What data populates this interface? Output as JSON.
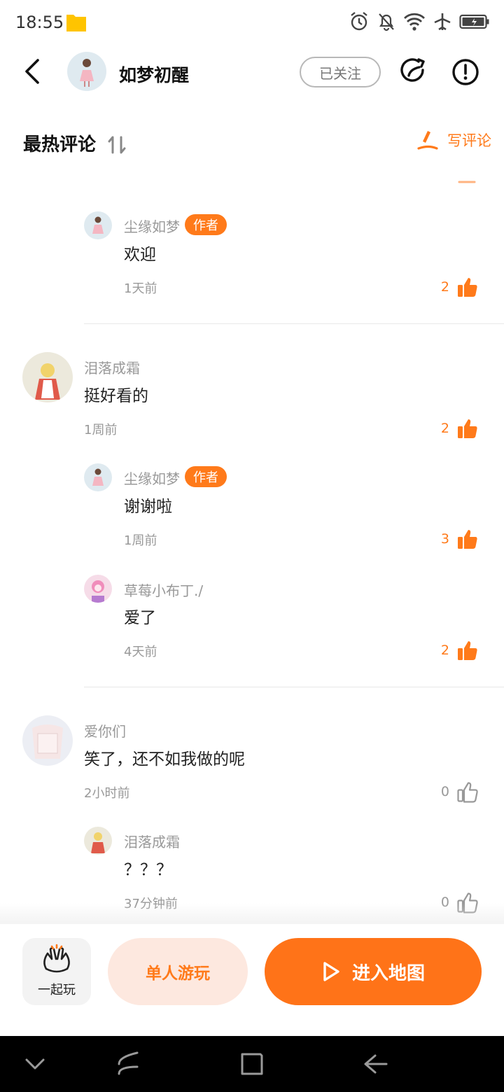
{
  "status_bar": {
    "time": "18:55",
    "icons": [
      "folder-icon",
      "alarm-icon",
      "notifications-off-icon",
      "wifi-icon",
      "airplane-icon",
      "battery-icon"
    ]
  },
  "header": {
    "title": "如梦初醒",
    "follow_label": "已关注",
    "icons": [
      "back-icon",
      "share-icon",
      "report-icon"
    ]
  },
  "section": {
    "title": "最热评论",
    "write_label": "写评论"
  },
  "comments": [
    {
      "kind": "reply",
      "name": "尘缘如梦",
      "tag": "作者",
      "text": "欢迎",
      "time": "1天前",
      "likes": "2",
      "liked": true
    },
    {
      "kind": "top",
      "name": "泪落成霜",
      "text": "挺好看的",
      "time": "1周前",
      "likes": "2",
      "liked": true,
      "replies": [
        {
          "name": "尘缘如梦",
          "tag": "作者",
          "text": "谢谢啦",
          "time": "1周前",
          "likes": "3",
          "liked": true
        },
        {
          "name": "草莓小布丁./",
          "text": "爱了",
          "time": "4天前",
          "likes": "2",
          "liked": true
        }
      ]
    },
    {
      "kind": "top",
      "name": "爱你们",
      "text": "笑了，还不如我做的呢",
      "time": "2小时前",
      "likes": "0",
      "liked": false,
      "replies": [
        {
          "name": "泪落成霜",
          "text": "？？？",
          "time": "37分钟前",
          "likes": "0",
          "liked": false
        }
      ]
    }
  ],
  "action_bar": {
    "play_together_label": "一起玩",
    "solo_label": "单人游玩",
    "enter_label": "进入地图"
  },
  "colors": {
    "accent": "#ff7318",
    "accent_light": "#fde8df",
    "muted_text": "#999999"
  }
}
